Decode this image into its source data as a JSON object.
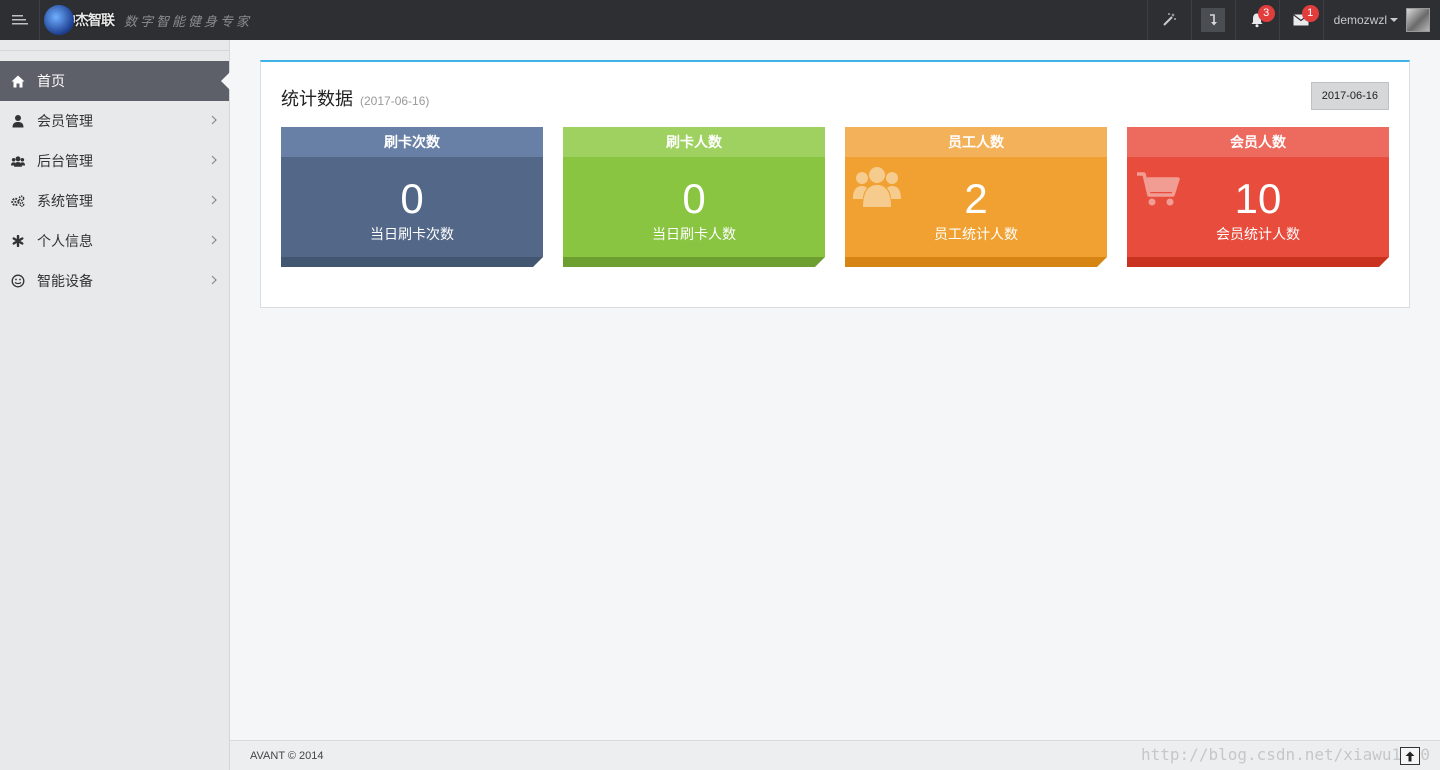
{
  "header": {
    "brand_name": "中杰智联",
    "brand_slogan": "数字智能健身专家",
    "notifications_count": "3",
    "messages_count": "1",
    "username": "demozwzl"
  },
  "sidebar": {
    "items": [
      {
        "label": "首页",
        "icon": "home-icon",
        "active": true
      },
      {
        "label": "会员管理",
        "icon": "user-icon"
      },
      {
        "label": "后台管理",
        "icon": "users-icon"
      },
      {
        "label": "系统管理",
        "icon": "cogs-icon"
      },
      {
        "label": "个人信息",
        "icon": "asterisk-icon"
      },
      {
        "label": "智能设备",
        "icon": "smile-icon"
      }
    ]
  },
  "panel": {
    "title": "统计数据",
    "subtitle": "(2017-06-16)",
    "date_button": "2017-06-16"
  },
  "tiles": [
    {
      "header": "刷卡次数",
      "value": "0",
      "label": "当日刷卡次数",
      "color": "#536888"
    },
    {
      "header": "刷卡人数",
      "value": "0",
      "label": "当日刷卡人数",
      "color": "#89c541"
    },
    {
      "header": "员工人数",
      "value": "2",
      "label": "员工统计人数",
      "color": "#f0a131",
      "icon": "group-icon"
    },
    {
      "header": "会员人数",
      "value": "10",
      "label": "会员统计人数",
      "color": "#e84c3d",
      "icon": "cart-icon"
    }
  ],
  "footer": {
    "copyright": "AVANT © 2014",
    "watermark": "http://blog.csdn.net/xiawu1990"
  }
}
